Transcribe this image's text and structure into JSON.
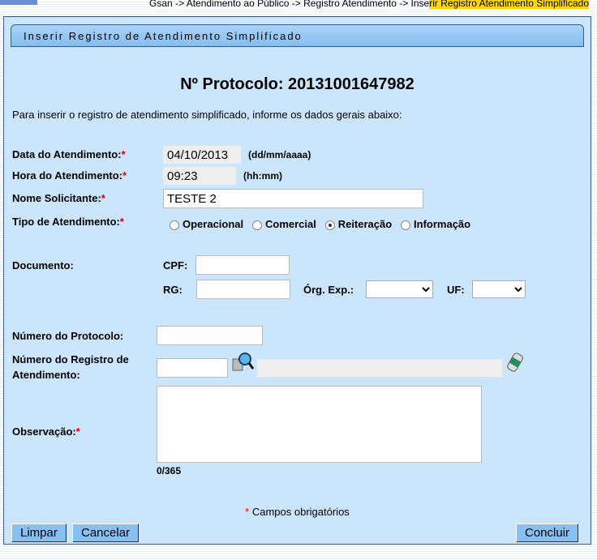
{
  "breadcrumb": {
    "path": "Gsan -> Atendimento ao Público -> Registro Atendimento -> Inse",
    "current": "rir Registro Atendimento Simplificado"
  },
  "title": "Inserir Registro de Atendimento Simplificado",
  "protocolo": "Nº Protocolo: 20131001647982",
  "instructions": "Para inserir o registro de atendimento simplificado, informe os dados gerais abaixo:",
  "fields": {
    "data_label": "Data do Atendimento:",
    "data_value": "04/10/2013",
    "data_hint": "(dd/mm/aaaa)",
    "hora_label": "Hora do Atendimento:",
    "hora_value": "09:23",
    "hora_hint": "(hh:mm)",
    "nome_label": "Nome Solicitante:",
    "nome_value": "TESTE 2",
    "tipo_label": "Tipo de Atendimento:",
    "tipo_options": [
      "Operacional",
      "Comercial",
      "Reiteração",
      "Informação"
    ],
    "tipo_selected": "Reiteração",
    "documento_label": "Documento:",
    "cpf_label": "CPF:",
    "rg_label": "RG:",
    "org_label": "Órg. Exp.:",
    "uf_label": "UF:",
    "num_protocolo_label": "Número do Protocolo:",
    "num_registro_label1": "Número do Registro de",
    "num_registro_label2": "Atendimento:",
    "obs_label": "Observação:",
    "obs_counter": "0/365",
    "required_mark": "*",
    "required_note": "Campos obrigatórios"
  },
  "buttons": {
    "limpar": "Limpar",
    "cancelar": "Cancelar",
    "concluir": "Concluir"
  }
}
